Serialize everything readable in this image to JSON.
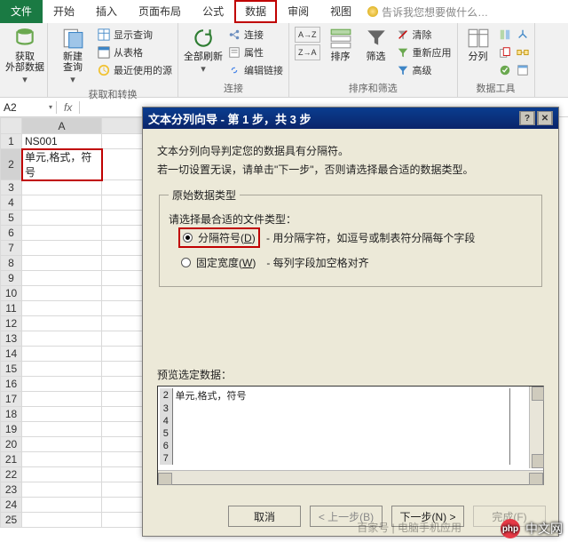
{
  "tabs": {
    "file": "文件",
    "home": "开始",
    "insert": "插入",
    "layout": "页面布局",
    "formulas": "公式",
    "data": "数据",
    "review": "审阅",
    "view": "视图",
    "tell_me": "告诉我您想要做什么…"
  },
  "ribbon": {
    "get_external": "获取\n外部数据",
    "new_query": "新建\n查询",
    "show_queries": "显示查询",
    "from_table": "从表格",
    "recent_sources": "最近使用的源",
    "group_get": "获取和转换",
    "refresh_all": "全部刷新",
    "connections": "连接",
    "properties": "属性",
    "edit_links": "编辑链接",
    "group_conn": "连接",
    "sort_az": "A↓Z",
    "sort_za": "Z↓A",
    "sort": "排序",
    "filter": "筛选",
    "clear": "清除",
    "reapply": "重新应用",
    "advanced": "高级",
    "group_sort": "排序和筛选",
    "text_to_columns": "分列",
    "group_tools": "数据工具"
  },
  "formula_bar": {
    "cell_ref": "A2"
  },
  "grid": {
    "col_a": "A",
    "a1": "NS001",
    "a2": "单元,格式，符号"
  },
  "dialog": {
    "title": "文本分列向导 - 第 1 步，共 3 步",
    "line1": "文本分列向导判定您的数据具有分隔符。",
    "line2": "若一切设置无误，请单击\"下一步\"，否则请选择最合适的数据类型。",
    "fieldset_title": "原始数据类型",
    "choose_label": "请选择最合适的文件类型：",
    "radio_delim": "分隔符号",
    "radio_delim_key": "D",
    "radio_delim_desc": "- 用分隔字符，如逗号或制表符分隔每个字段",
    "radio_fixed": "固定宽度",
    "radio_fixed_key": "W",
    "radio_fixed_desc": "- 每列字段加空格对齐",
    "preview_label": "预览选定数据：",
    "preview_row_num": "2",
    "preview_row_text": "单元,格式，符号",
    "btn_cancel": "取消",
    "btn_back": "< 上一步(B)",
    "btn_next": "下一步(N) >",
    "btn_finish": "完成(F)"
  },
  "watermark": {
    "text": "中文网",
    "php": "php",
    "other": "百家号 | 电脑手机应用"
  }
}
